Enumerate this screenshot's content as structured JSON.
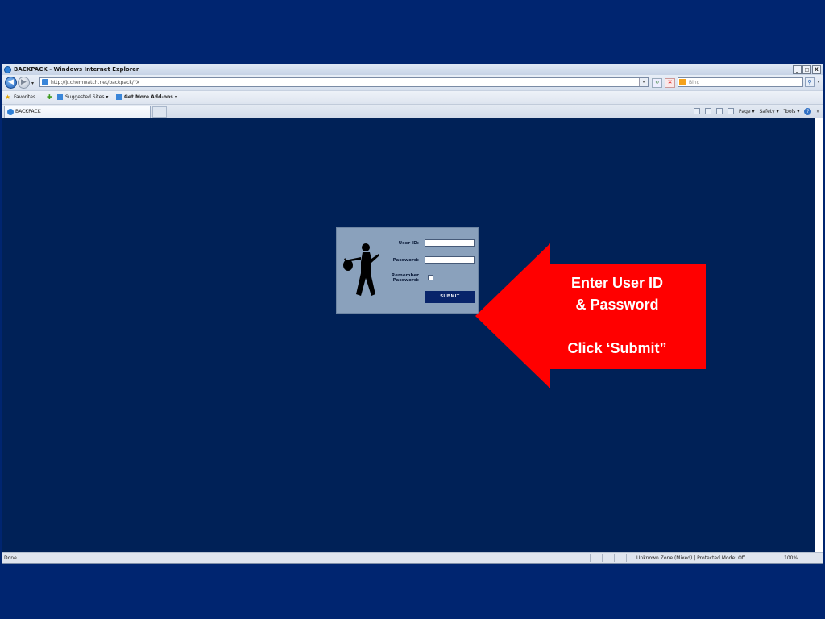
{
  "browser": {
    "window_title": "BACKPACK - Windows Internet Explorer",
    "window_buttons": [
      "_",
      "□",
      "X"
    ],
    "address_url": "http://jr.chemwatch.net/backpack/?X",
    "search_placeholder": "Bing",
    "favorites_label": "Favorites",
    "suggested_sites_label": "Suggested Sites ▾",
    "get_addons_label": "Get More Add-ons ▾",
    "tab_title": "BACKPACK",
    "command_bar": {
      "page_label": "Page ▾",
      "safety_label": "Safety ▾",
      "tools_label": "Tools ▾",
      "help_label": "?",
      "more_label": "»"
    },
    "status": {
      "left_text": "Done",
      "zone_text": "Unknown Zone (Mixed) | Protected Mode: Off",
      "zoom_text": "100%"
    }
  },
  "login_form": {
    "user_id_label": "User ID:",
    "password_label": "Password:",
    "remember_label_line1": "Remember",
    "remember_label_line2": "Password:",
    "user_id_value": "",
    "password_value": "",
    "remember_checked": false,
    "submit_label": "SUBMIT"
  },
  "callout": {
    "line1": "Enter  User ID",
    "line2": "& Password",
    "line3": "",
    "line4": "Click ‘Submit”",
    "color": "#ff0000"
  },
  "colors": {
    "slide_background": "#002570",
    "page_background": "#002157",
    "login_panel": "#8aa1bc",
    "submit_button": "#08246a"
  }
}
